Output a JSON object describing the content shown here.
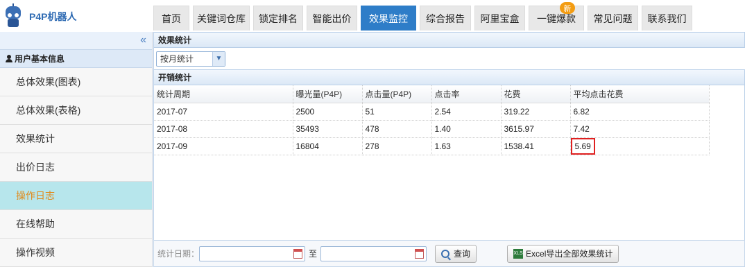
{
  "app": {
    "logo_text": "P4P机器人"
  },
  "nav": {
    "tabs": [
      {
        "label": "首页",
        "width": 52
      },
      {
        "label": "关键词仓库",
        "width": 82
      },
      {
        "label": "锁定排名",
        "width": 72
      },
      {
        "label": "智能出价",
        "width": 73
      },
      {
        "label": "效果监控",
        "width": 80,
        "active": true
      },
      {
        "label": "综合报告",
        "width": 74
      },
      {
        "label": "阿里宝盒",
        "width": 73
      },
      {
        "label": "一键爆款",
        "width": 80,
        "badge": "新"
      },
      {
        "label": "常见问题",
        "width": 73
      },
      {
        "label": "联系我们",
        "width": 73
      }
    ]
  },
  "sidebar": {
    "collapse_glyph": "«",
    "section_title": "用户基本信息",
    "items": [
      {
        "label": "总体效果(图表)"
      },
      {
        "label": "总体效果(表格)"
      },
      {
        "label": "效果统计"
      },
      {
        "label": "出价日志"
      },
      {
        "label": "操作日志",
        "active": true
      },
      {
        "label": "在线帮助"
      },
      {
        "label": "操作视频"
      }
    ]
  },
  "main": {
    "stats_title": "效果统计",
    "period_select": {
      "value": "按月统计"
    },
    "expense_title": "开销统计",
    "table": {
      "headers": [
        "统计周期",
        "曝光量(P4P)",
        "点击量(P4P)",
        "点击率",
        "花费",
        "平均点击花费"
      ],
      "rows": [
        [
          "2017-07",
          "2500",
          "51",
          "2.54",
          "319.22",
          "6.82"
        ],
        [
          "2017-08",
          "35493",
          "478",
          "1.40",
          "3615.97",
          "7.42"
        ],
        [
          "2017-09",
          "16804",
          "278",
          "1.63",
          "1538.41",
          "5.69"
        ]
      ],
      "highlighted_cell": {
        "row": 2,
        "col": 5
      },
      "highlight_color": "#e02020"
    },
    "footer": {
      "date_label": "统计日期：",
      "to_label": "至",
      "query_label": "查询",
      "export_label": "Excel导出全部效果统计",
      "export_icon_text": "XLS"
    }
  },
  "colors": {
    "accent": "#2e7dc8",
    "active_menu_bg": "#b7e6ec",
    "active_menu_text": "#e08a1c"
  }
}
